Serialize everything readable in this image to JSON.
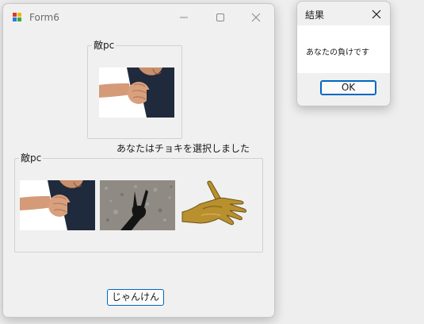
{
  "window": {
    "title": "Form6",
    "icon": "form-app-icon",
    "controls": {
      "minimize_icon": "minimize-icon",
      "maximize_icon": "maximize-icon",
      "close_icon": "close-icon"
    }
  },
  "enemy_group": {
    "legend": "敵pc",
    "image": "fist-photo"
  },
  "selection_message": "あなたはチョキを選択しました",
  "choice_group": {
    "legend": "敵pc",
    "images": [
      "fist-photo",
      "peace-sign-shadow-photo",
      "golden-open-hand-photo"
    ]
  },
  "janken_button": "じゃんけん",
  "dialog": {
    "title": "結果",
    "message": "あなたの負けです",
    "ok_button": "OK",
    "close_icon": "close-icon"
  },
  "colors": {
    "accent": "#0067c0",
    "window_bg": "#f0f0f0",
    "dialog_body_bg": "#ffffff",
    "desktop_bg": "#eeeeee"
  }
}
